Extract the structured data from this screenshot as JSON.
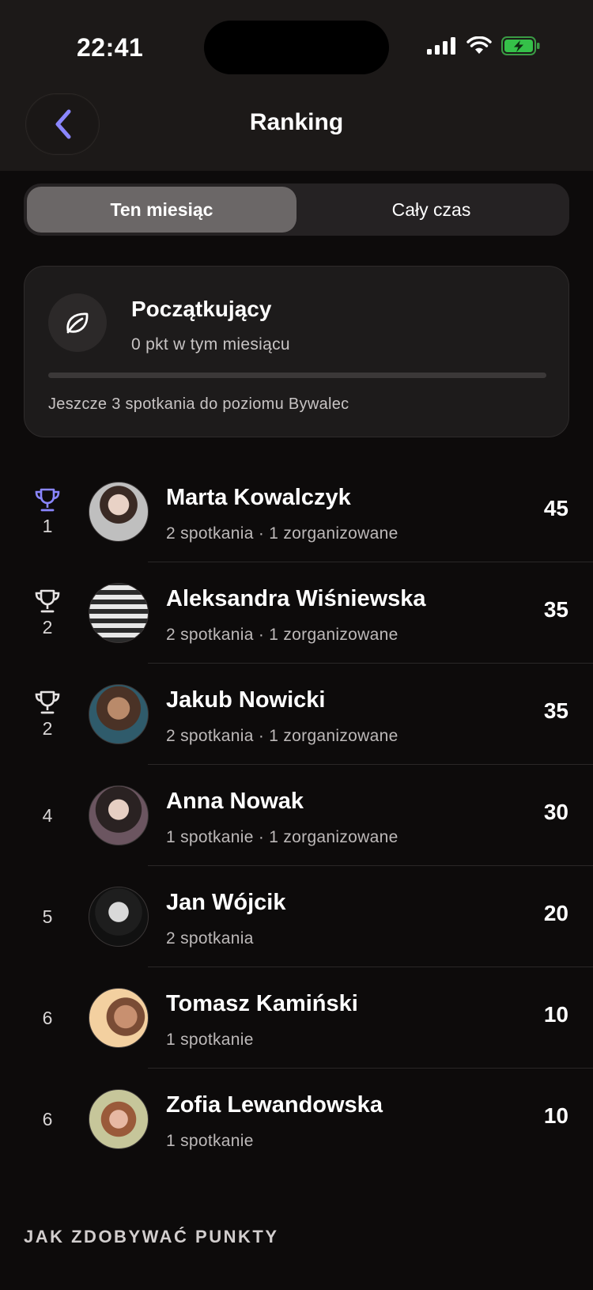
{
  "status_bar": {
    "time": "22:41"
  },
  "header": {
    "title": "Ranking"
  },
  "tabs": [
    {
      "label": "Ten miesiąc",
      "active": true
    },
    {
      "label": "Cały czas",
      "active": false
    }
  ],
  "level": {
    "icon": "leaf-icon",
    "title": "Początkujący",
    "points": "0 pkt w tym miesiącu",
    "progress": 0,
    "hint": "Jeszcze 3 spotkania do poziomu Bywalec"
  },
  "ranking": [
    {
      "rank": "1",
      "trophy": true,
      "trophy_color": "#8a86ff",
      "name": "Marta Kowalczyk",
      "meta": "2 spotkania · 1 zorganizowane",
      "score": "45"
    },
    {
      "rank": "2",
      "trophy": true,
      "trophy_color": "#e6e3e3",
      "name": "Aleksandra Wiśniewska",
      "meta": "2 spotkania · 1 zorganizowane",
      "score": "35"
    },
    {
      "rank": "2",
      "trophy": true,
      "trophy_color": "#e6e3e3",
      "name": "Jakub Nowicki",
      "meta": "2 spotkania · 1 zorganizowane",
      "score": "35"
    },
    {
      "rank": "4",
      "trophy": false,
      "name": "Anna Nowak",
      "meta": "1 spotkanie · 1 zorganizowane",
      "score": "30"
    },
    {
      "rank": "5",
      "trophy": false,
      "name": "Jan Wójcik",
      "meta": "2 spotkania",
      "score": "20"
    },
    {
      "rank": "6",
      "trophy": false,
      "name": "Tomasz Kamiński",
      "meta": "1 spotkanie",
      "score": "10"
    },
    {
      "rank": "6",
      "trophy": false,
      "name": "Zofia Lewandowska",
      "meta": "1 spotkanie",
      "score": "10"
    }
  ],
  "section": {
    "title": "JAK ZDOBYWAĆ PUNKTY"
  },
  "colors": {
    "accent": "#8a86ff",
    "background": "#0d0b0b",
    "card": "#1d1b1b"
  }
}
